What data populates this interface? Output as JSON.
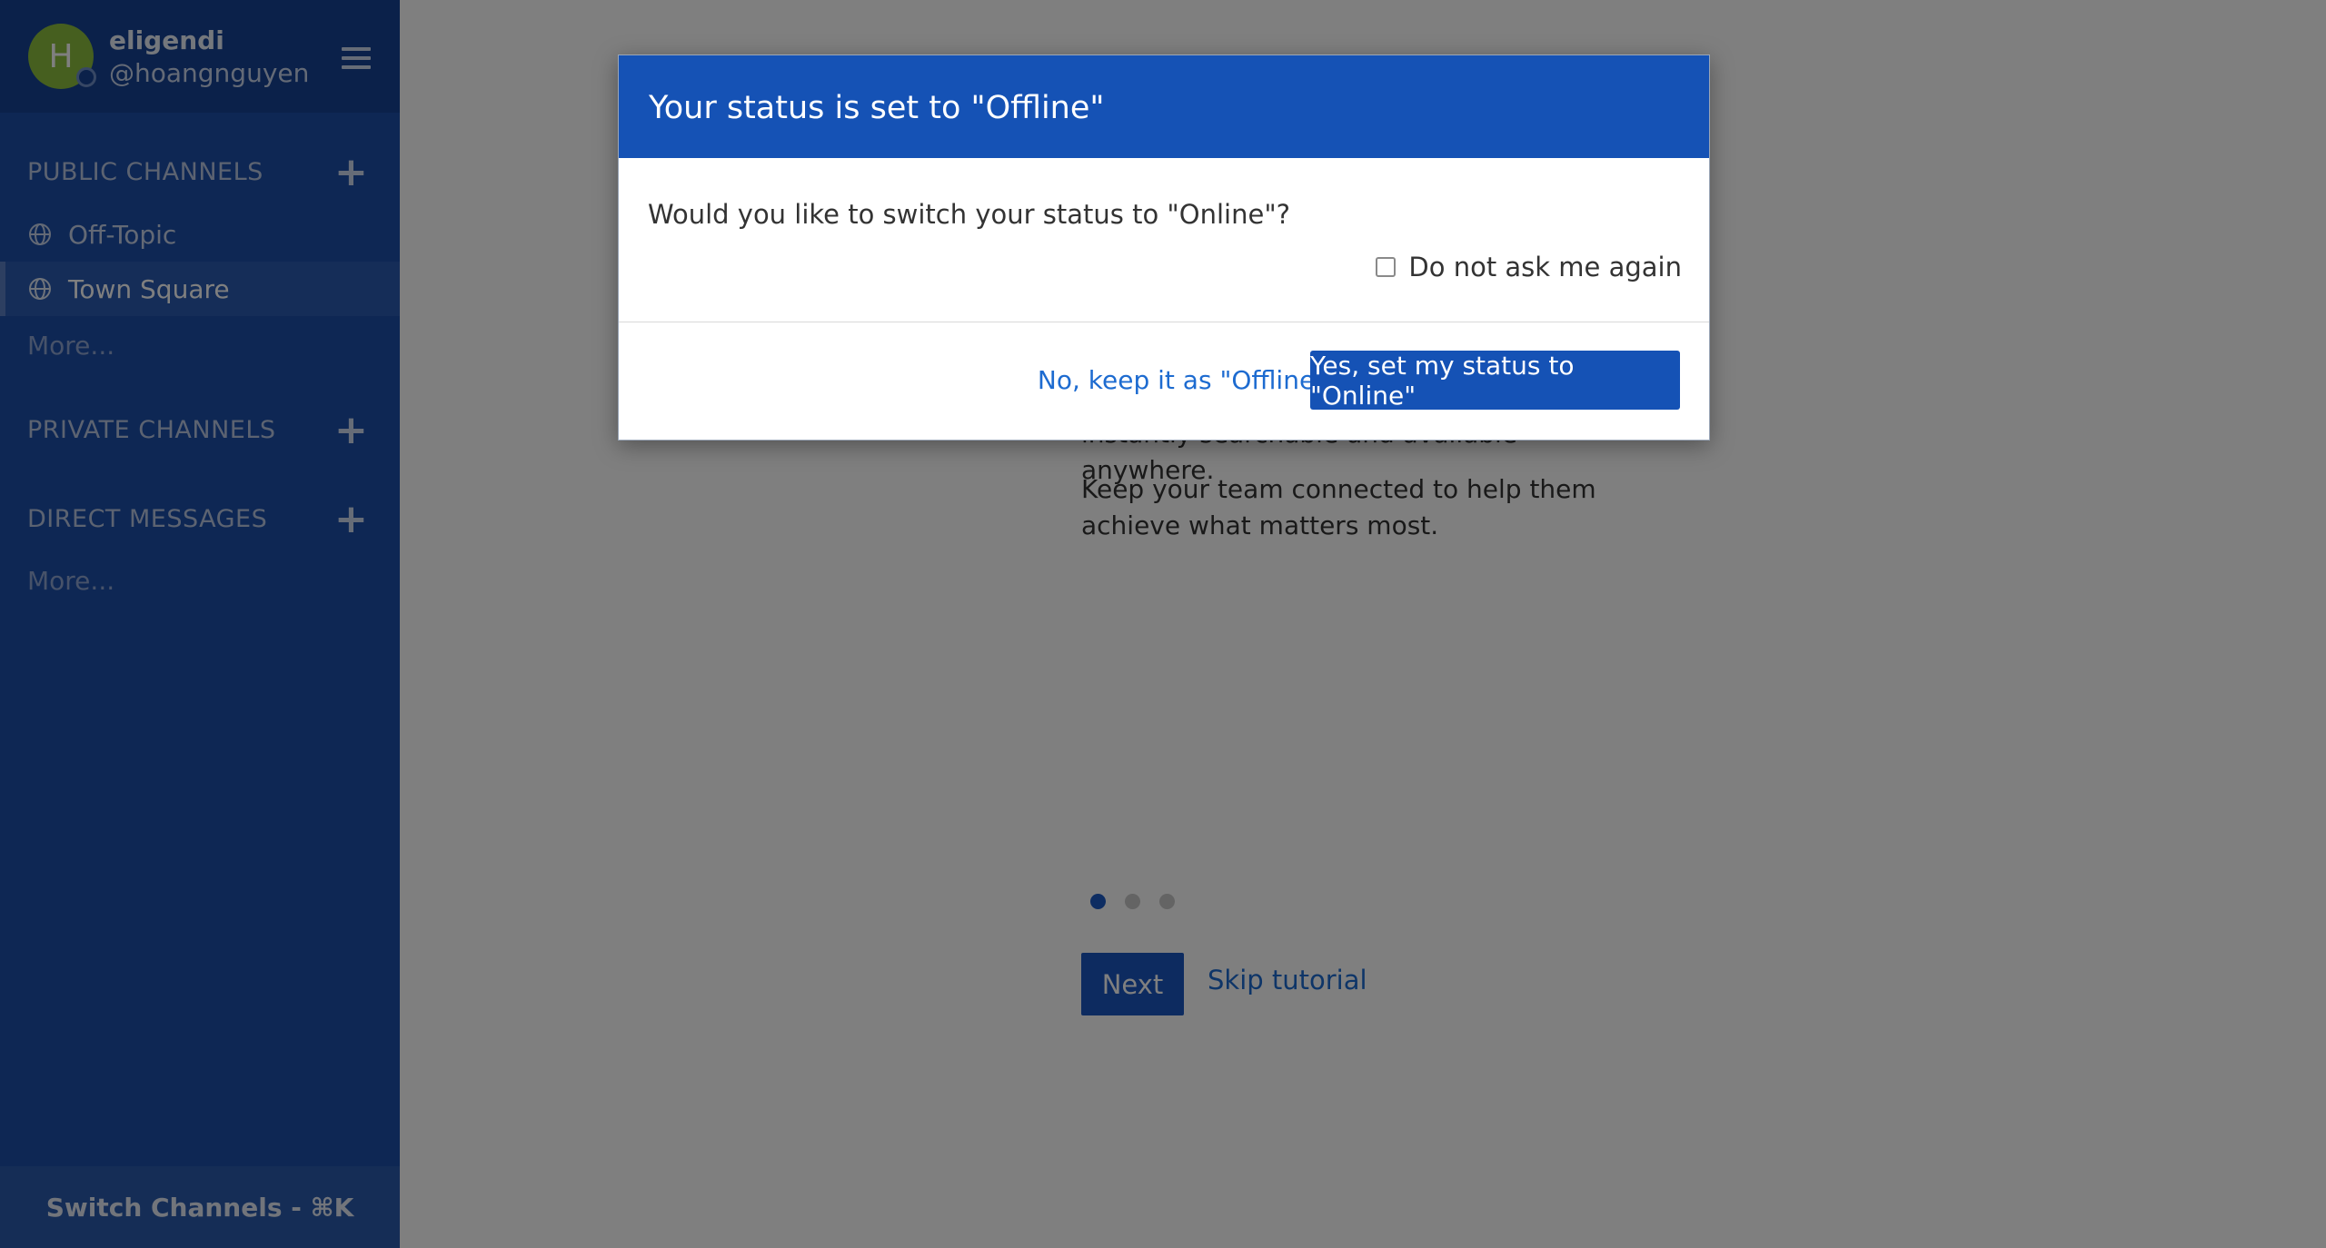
{
  "sidebar": {
    "user": {
      "avatar_initial": "H",
      "username": "eligendi",
      "handle": "@hoangnguyen",
      "avatar_color": "#8cbf3f"
    },
    "public_channels": {
      "heading": "PUBLIC CHANNELS",
      "items": [
        {
          "label": "Off-Topic",
          "icon": "globe-icon",
          "active": false
        },
        {
          "label": "Town Square",
          "icon": "globe-icon",
          "active": true
        }
      ],
      "more": "More..."
    },
    "private_channels": {
      "heading": "PRIVATE CHANNELS"
    },
    "direct_messages": {
      "heading": "DIRECT MESSAGES",
      "more": "More..."
    },
    "switch_channels": "Switch Channels - ⌘K",
    "colors": {
      "background": "#1d4fa8",
      "header": "#164294"
    }
  },
  "main": {
    "tutorial": {
      "partial_line": "instantly searchable and available anywhere.",
      "body_line1": "Keep your team connected to help them",
      "body_line2": "achieve what matters most.",
      "pager": {
        "total": 3,
        "current": 1
      },
      "next_label": "Next",
      "skip_label": "Skip tutorial"
    }
  },
  "modal": {
    "title": "Your status is set to \"Offline\"",
    "question": "Would you like to switch your status to \"Online\"?",
    "checkbox_label": "Do not ask me again",
    "checkbox_checked": false,
    "secondary_button": "No, keep it as \"Offline\"",
    "primary_button": "Yes, set my status to \"Online\"",
    "colors": {
      "header": "#1552b5",
      "link": "#1d6bd0"
    }
  }
}
